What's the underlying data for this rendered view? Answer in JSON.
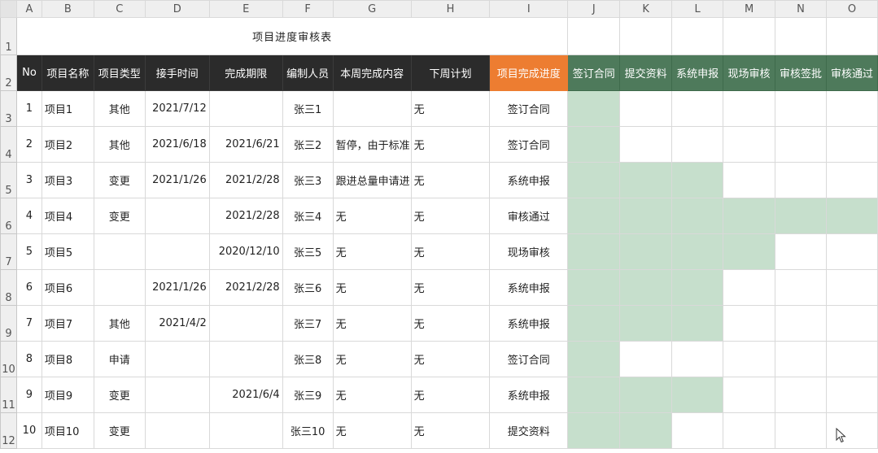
{
  "columns": [
    "A",
    "B",
    "C",
    "D",
    "E",
    "F",
    "G",
    "H",
    "I",
    "J",
    "K",
    "L",
    "M",
    "N",
    "O"
  ],
  "title": "项目进度审核表",
  "headers": {
    "no": "No",
    "name": "项目名称",
    "type": "项目类型",
    "start": "接手时间",
    "deadline": "完成期限",
    "author": "编制人员",
    "this_week": "本周完成内容",
    "next_week": "下周计划",
    "progress": "项目完成进度",
    "stages": [
      "签订合同",
      "提交资料",
      "系统申报",
      "现场审核",
      "审核签批",
      "审核通过"
    ]
  },
  "rows": [
    {
      "row": "3",
      "no": "1",
      "name": "项目1",
      "type": "其他",
      "start": "2021/7/12",
      "deadline": "",
      "author": "张三1",
      "this_week": "",
      "next_week": "无",
      "progress": "签订合同",
      "stage_level": 1
    },
    {
      "row": "4",
      "no": "2",
      "name": "项目2",
      "type": "其他",
      "start": "2021/6/18",
      "deadline": "2021/6/21",
      "author": "张三2",
      "this_week": "暂停，由于标准",
      "next_week": "无",
      "progress": "签订合同",
      "stage_level": 1
    },
    {
      "row": "5",
      "no": "3",
      "name": "项目3",
      "type": "变更",
      "start": "2021/1/26",
      "deadline": "2021/2/28",
      "author": "张三3",
      "this_week": "跟进总量申请进",
      "next_week": "无",
      "progress": "系统申报",
      "stage_level": 3
    },
    {
      "row": "6",
      "no": "4",
      "name": "项目4",
      "type": "变更",
      "start": "",
      "deadline": "2021/2/28",
      "author": "张三4",
      "this_week": "无",
      "next_week": "无",
      "progress": "审核通过",
      "stage_level": 6
    },
    {
      "row": "7",
      "no": "5",
      "name": "项目5",
      "type": "",
      "start": "",
      "deadline": "2020/12/10",
      "author": "张三5",
      "this_week": "无",
      "next_week": "无",
      "progress": "现场审核",
      "stage_level": 4
    },
    {
      "row": "8",
      "no": "6",
      "name": "项目6",
      "type": "",
      "start": "2021/1/26",
      "deadline": "2021/2/28",
      "author": "张三6",
      "this_week": "无",
      "next_week": "无",
      "progress": "系统申报",
      "stage_level": 3
    },
    {
      "row": "9",
      "no": "7",
      "name": "项目7",
      "type": "其他",
      "start": "2021/4/2",
      "deadline": "",
      "author": "张三7",
      "this_week": "无",
      "next_week": "无",
      "progress": "系统申报",
      "stage_level": 3
    },
    {
      "row": "10",
      "no": "8",
      "name": "项目8",
      "type": "申请",
      "start": "",
      "deadline": "",
      "author": "张三8",
      "this_week": "无",
      "next_week": "无",
      "progress": "签订合同",
      "stage_level": 1
    },
    {
      "row": "11",
      "no": "9",
      "name": "项目9",
      "type": "变更",
      "start": "",
      "deadline": "2021/6/4",
      "author": "张三9",
      "this_week": "无",
      "next_week": "无",
      "progress": "系统申报",
      "stage_level": 3
    },
    {
      "row": "12",
      "no": "10",
      "name": "项目10",
      "type": "变更",
      "start": "",
      "deadline": "",
      "author": "张三10",
      "this_week": "无",
      "next_week": "无",
      "progress": "提交资料",
      "stage_level": 2
    }
  ],
  "colors": {
    "header_dark": "#2b2b2b",
    "header_orange": "#ed7d31",
    "header_green": "#4e7a5b",
    "progress_fill": "#c6dfcc"
  }
}
